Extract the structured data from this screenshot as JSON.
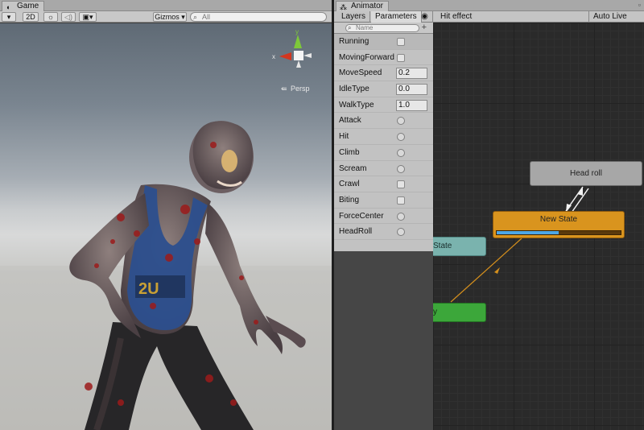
{
  "game_panel": {
    "tab_title": "Game",
    "tab_icon": "pacman-icon",
    "toolbar": {
      "shading_mode": "",
      "mode_2d": "2D",
      "lighting_icon": "sun-icon",
      "audio_icon": "speaker-icon",
      "effects_icon": "image-icon",
      "gizmos": "Gizmos",
      "search_placeholder": "All"
    },
    "scene_gizmo": {
      "y_label": "y",
      "x_label": "x",
      "persp_label": "Persp"
    }
  },
  "animator_panel": {
    "tab_title": "Animator",
    "tabs": [
      "Layers",
      "Parameters"
    ],
    "eye_icon": "eye-icon",
    "breadcrumb": "Hit effect",
    "auto_live_link": "Auto Live Link",
    "param_search_placeholder": "Name",
    "add_label": "+",
    "parameters": [
      {
        "name": "Running",
        "type": "bool",
        "value": false
      },
      {
        "name": "MovingForward",
        "type": "bool",
        "value": false
      },
      {
        "name": "MoveSpeed",
        "type": "float",
        "value": "0.2"
      },
      {
        "name": "IdleType",
        "type": "float",
        "value": "0.0"
      },
      {
        "name": "WalkType",
        "type": "float",
        "value": "1.0"
      },
      {
        "name": "Attack",
        "type": "trigger",
        "value": false
      },
      {
        "name": "Hit",
        "type": "trigger",
        "value": false
      },
      {
        "name": "Climb",
        "type": "trigger",
        "value": false
      },
      {
        "name": "Scream",
        "type": "trigger",
        "value": false
      },
      {
        "name": "Crawl",
        "type": "bool",
        "value": false
      },
      {
        "name": "Biting",
        "type": "bool",
        "value": false
      },
      {
        "name": "ForceCenter",
        "type": "trigger",
        "value": false
      },
      {
        "name": "HeadRoll",
        "type": "trigger",
        "value": false
      }
    ],
    "graph": {
      "nodes": {
        "head_roll": "Head roll",
        "new_state": "New State",
        "teal_state": "State",
        "green_state": "y"
      },
      "new_state_progress": 0.5,
      "colors": {
        "default": "#a7a7a7",
        "active": "#d9941e",
        "entry": "#3ca73a",
        "teal": "#7ab3ae",
        "progress": "#4ea7e6"
      }
    }
  }
}
